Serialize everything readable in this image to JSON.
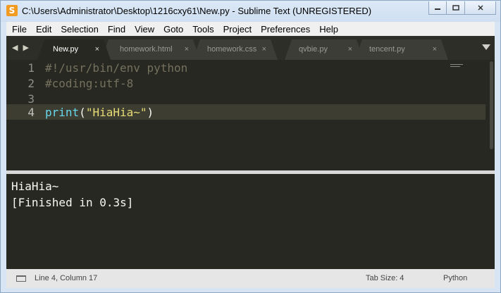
{
  "window": {
    "title": "C:\\Users\\Administrator\\Desktop\\1216cxy61\\New.py - Sublime Text (UNREGISTERED)",
    "app_icon": "S",
    "controls": [
      "minimize-icon",
      "restore-icon",
      "close-icon"
    ]
  },
  "menu": [
    "File",
    "Edit",
    "Selection",
    "Find",
    "View",
    "Goto",
    "Tools",
    "Project",
    "Preferences",
    "Help"
  ],
  "tabbar": {
    "nav": "◀ ▶",
    "tabs": [
      {
        "label": "New.py",
        "close": "×"
      },
      {
        "label": "homework.html",
        "close": "×"
      },
      {
        "label": "homework.css",
        "close": "×"
      },
      {
        "label": "qvbie.py",
        "close": "×"
      },
      {
        "label": "tencent.py",
        "close": "×"
      }
    ]
  },
  "editor": {
    "line_numbers": [
      "1",
      "2",
      "3",
      "4"
    ],
    "lines": {
      "l1": "#!/usr/bin/env python",
      "l2": "#coding:utf-8",
      "l3": "",
      "l4_fn": "print",
      "l4_open": "(",
      "l4_str": "\"HiaHia~\"",
      "l4_close": ")"
    }
  },
  "output": {
    "lines": [
      "HiaHia~",
      "[Finished in 0.3s]"
    ]
  },
  "status": {
    "position": "Line 4, Column 17",
    "tab_size": "Tab Size: 4",
    "syntax": "Python"
  },
  "colors": {
    "editor_bg": "#272822",
    "comment": "#75715e",
    "function": "#66d9ef",
    "string": "#e6db74"
  }
}
